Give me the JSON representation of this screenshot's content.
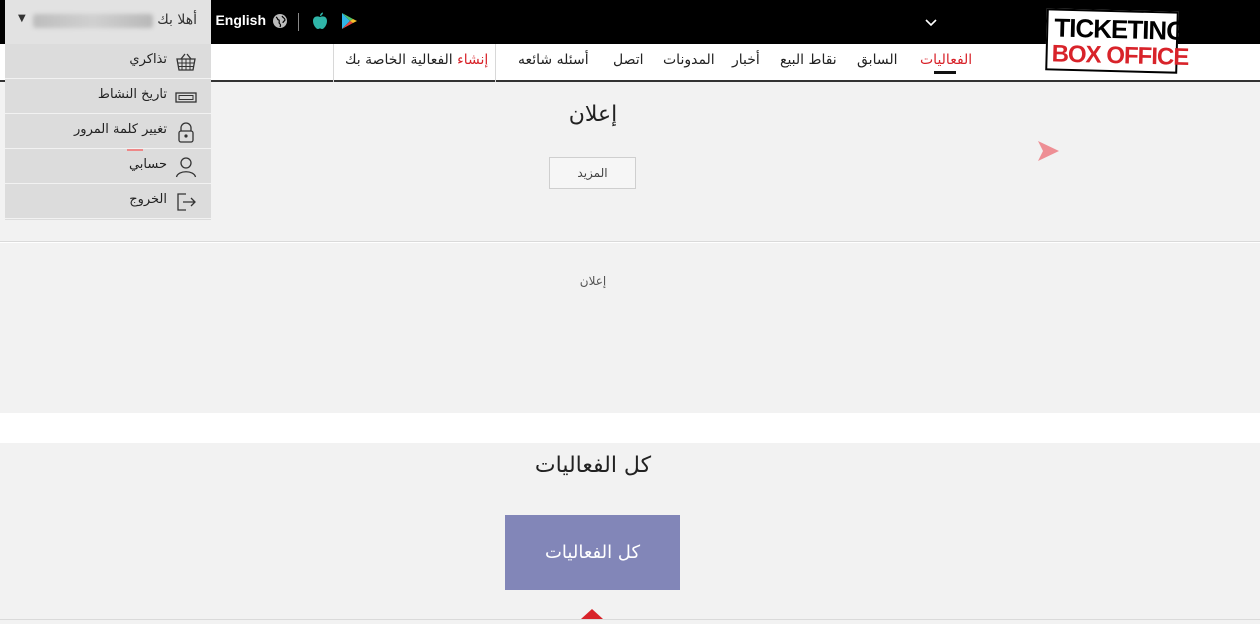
{
  "brand": {
    "logo_line1": "TICKETING",
    "logo_line2": "BOX OFFICE"
  },
  "topbar": {
    "language_label": "English"
  },
  "nav": {
    "items": [
      {
        "key": "events",
        "label": "الفعاليات"
      },
      {
        "key": "past",
        "label": "السابق"
      },
      {
        "key": "sales-points",
        "label": "نقاط البيع"
      },
      {
        "key": "news",
        "label": "أخبار"
      },
      {
        "key": "blogs",
        "label": "المدونات"
      },
      {
        "key": "contact",
        "label": "اتصل"
      },
      {
        "key": "faq",
        "label": "أسئله شائعه"
      }
    ],
    "create_event_red": "إنشاء",
    "create_event_rest": "الفعالية الخاصة بك"
  },
  "user": {
    "greeting": "أهلا بك",
    "menu": [
      {
        "key": "tickets",
        "label": "تذاكري",
        "icon": "basket-icon"
      },
      {
        "key": "activity",
        "label": "تاريخ النشاط",
        "icon": "ticket-icon"
      },
      {
        "key": "password",
        "label": "تغيير كلمة المرور",
        "icon": "lock-icon"
      },
      {
        "key": "account",
        "label": "حسابي",
        "icon": "user-icon"
      },
      {
        "key": "logout",
        "label": "الخروج",
        "icon": "logout-icon"
      }
    ]
  },
  "content": {
    "ad_title": "إعلان",
    "more_label": "المزيد",
    "ad_label": "إعلان",
    "all_events_title": "كل الفعاليات",
    "all_events_button": "كل الفعاليات"
  },
  "colors": {
    "accent_red": "#d8232a",
    "button_purple": "#8286b8",
    "bar_black": "#000000"
  }
}
